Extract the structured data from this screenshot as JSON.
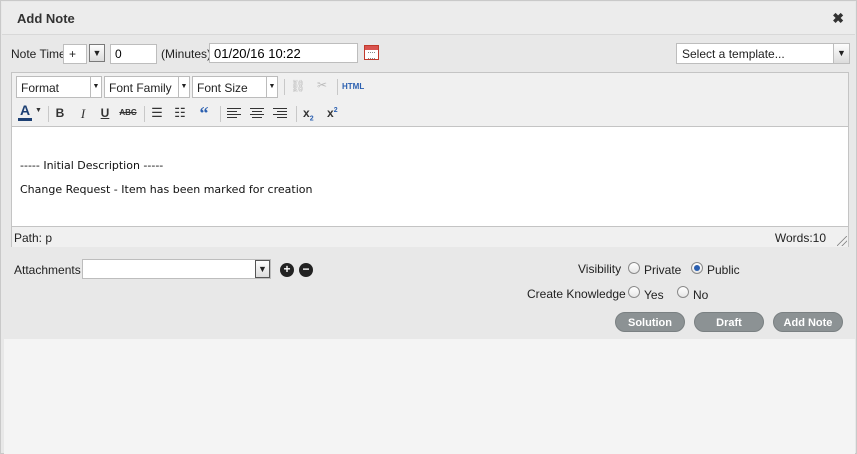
{
  "dialog": {
    "title": "Add Note",
    "close_glyph": "✖"
  },
  "note_time": {
    "label": "Note Time",
    "sign": "+",
    "minutes_value": "0",
    "minutes_unit": "(Minutes)",
    "datetime": "01/20/16 10:22"
  },
  "template": {
    "placeholder": "Select a template..."
  },
  "editor": {
    "format_label": "Format",
    "font_family_label": "Font Family",
    "font_size_label": "Font Size",
    "html_label": "HTML",
    "content_lines": [
      "----- Initial Description -----",
      "Change Request - Item has been marked for creation"
    ],
    "path_label": "Path: p",
    "words_label": "Words:10"
  },
  "attachments": {
    "label": "Attachments"
  },
  "visibility": {
    "label": "Visibility",
    "options": [
      "Private",
      "Public"
    ],
    "selected": "Public"
  },
  "create_knowledge": {
    "label": "Create Knowledge",
    "options": [
      "Yes",
      "No"
    ],
    "selected": null
  },
  "buttons": {
    "solution": "Solution",
    "draft": "Draft",
    "add_note": "Add Note"
  },
  "colors": {
    "button_bg": "#8c9294",
    "radio_selected": "#2a5fb0",
    "calendar_accent": "#d9534f"
  },
  "icons": [
    "close-icon",
    "dropdown-arrow-icon",
    "calendar-icon",
    "link-icon",
    "unlink-icon",
    "font-color-icon",
    "bold-icon",
    "italic-icon",
    "underline-icon",
    "strikethrough-icon",
    "bullet-list-icon",
    "numbered-list-icon",
    "blockquote-icon",
    "align-left-icon",
    "align-center-icon",
    "align-right-icon",
    "subscript-icon",
    "superscript-icon",
    "resize-grip-icon",
    "add-icon",
    "remove-icon"
  ]
}
